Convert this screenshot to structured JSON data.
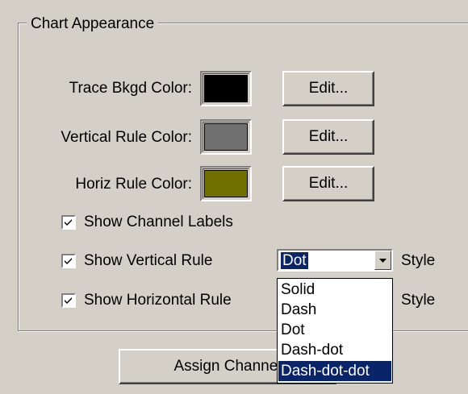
{
  "group": {
    "title": "Chart Appearance"
  },
  "colors": [
    {
      "label": "Trace Bkgd Color:",
      "color": "#000000",
      "button": "Edit..."
    },
    {
      "label": "Vertical Rule Color:",
      "color": "#707070",
      "button": "Edit..."
    },
    {
      "label": "Horiz Rule Color:",
      "color": "#707000",
      "button": "Edit..."
    }
  ],
  "checkboxes": [
    {
      "label": "Show Channel Labels",
      "checked": true
    },
    {
      "label": "Show Vertical Rule",
      "checked": true
    },
    {
      "label": "Show Horizontal Rule",
      "checked": true
    }
  ],
  "style_select": {
    "value": "Dot",
    "label_vertical": "Style",
    "label_horizontal": "Style",
    "options": [
      "Solid",
      "Dash",
      "Dot",
      "Dash-dot",
      "Dash-dot-dot"
    ],
    "highlighted": "Dash-dot-dot"
  },
  "assign_button": "Assign Channel"
}
